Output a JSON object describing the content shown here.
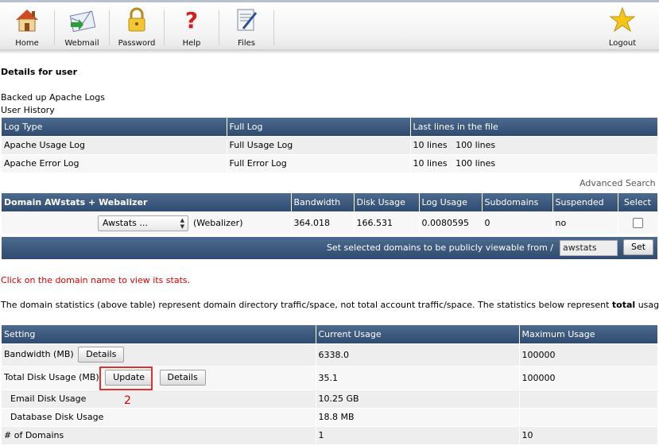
{
  "toolbar": {
    "items": [
      {
        "label": "Home",
        "icon": "home-icon"
      },
      {
        "label": "Webmail",
        "icon": "webmail-icon"
      },
      {
        "label": "Password",
        "icon": "lock-icon"
      },
      {
        "label": "Help",
        "icon": "help-icon"
      },
      {
        "label": "Files",
        "icon": "files-icon"
      }
    ],
    "logout": {
      "label": "Logout",
      "icon": "star-icon"
    }
  },
  "page": {
    "heading": "Details for user",
    "backed_up": "Backed up Apache Logs",
    "user_history": "User History"
  },
  "logs_table": {
    "headers": [
      "Log Type",
      "Full Log",
      "Last lines in the file"
    ],
    "rows": [
      {
        "type": "Apache Usage Log",
        "full": "Full Usage Log",
        "ten": "10 lines",
        "hundred": "100 lines"
      },
      {
        "type": "Apache Error Log",
        "full": "Full Error Log",
        "ten": "10 lines",
        "hundred": "100 lines"
      }
    ]
  },
  "advanced_search": "Advanced Search",
  "domains_table": {
    "headers": [
      "Domain AWstats + Webalizer",
      "Bandwidth",
      "Disk Usage",
      "Log Usage",
      "Subdomains",
      "Suspended",
      "Select"
    ],
    "row": {
      "stats_select": "Awstats ...",
      "webalizer": "(Webalizer)",
      "bandwidth": "364.018",
      "disk_usage": "166.531",
      "log_usage": "0.0080595",
      "subdomains": "0",
      "suspended": "no"
    },
    "footer_text": "Set selected domains to be publicly viewable from /",
    "footer_input_value": "awstats",
    "footer_button": "Set"
  },
  "notes": {
    "click_note": "Click on the domain name to view its stats.",
    "stats_para_start": "The domain statistics (above table) represent domain directory traffic/space, not total account traffic/space. The statistics below represent ",
    "stats_para_bold": "total",
    "stats_para_end": " usage."
  },
  "usage_table": {
    "headers": [
      "Setting",
      "Current Usage",
      "Maximum Usage"
    ],
    "rows": {
      "bandwidth": {
        "label": "Bandwidth (MB)",
        "current": "6338.0",
        "max": "100000",
        "details": "Details"
      },
      "disk": {
        "label": "Total Disk Usage (MB)",
        "current": "35.1",
        "max": "100000",
        "update": "Update",
        "details": "Details"
      },
      "email": {
        "label": "Email Disk Usage",
        "current": "10.25 GB",
        "max": ""
      },
      "database": {
        "label": "Database Disk Usage",
        "current": "18.8 MB",
        "max": ""
      },
      "domains": {
        "label": "# of Domains",
        "current": "1",
        "max": "10"
      }
    }
  },
  "annotation": "2"
}
